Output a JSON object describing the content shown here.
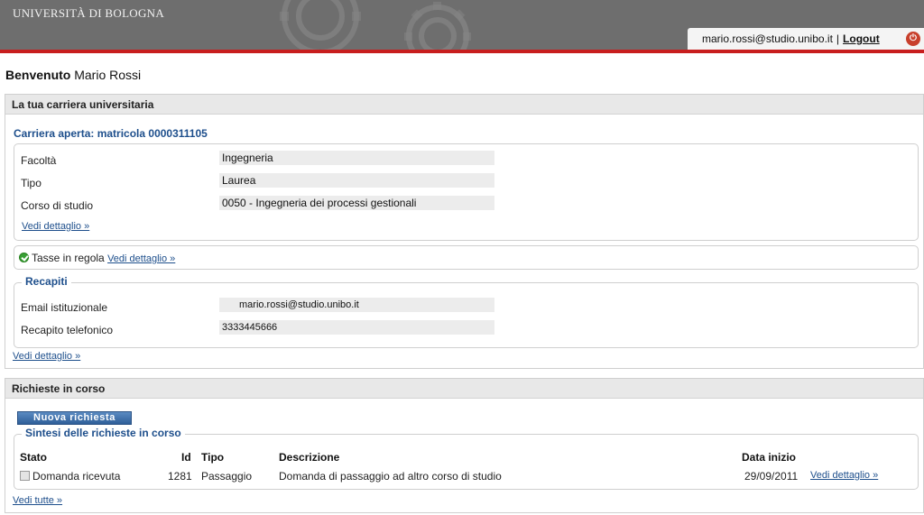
{
  "header": {
    "brand": "UNIVERSITÀ DI BOLOGNA",
    "user_email": "mario.rossi@studio.unibo.it",
    "separator": "|",
    "logout_label": "Logout",
    "accent_color": "#c81e1e"
  },
  "welcome": {
    "prefix": "Benvenuto",
    "name": "Mario Rossi"
  },
  "career": {
    "panel_title": "La tua carriera universitaria",
    "section_title": "Carriera aperta: matricola 0000311105",
    "fields": [
      {
        "label": "Facoltà",
        "value": "Ingegneria"
      },
      {
        "label": "Tipo",
        "value": "Laurea"
      },
      {
        "label": "Corso di studio",
        "value": "0050 - Ingegneria dei processi gestionali"
      }
    ],
    "details_link": "Vedi dettaglio »",
    "taxes_status": "Tasse in regola",
    "taxes_link": "Vedi dettaglio »",
    "contacts": {
      "legend": "Recapiti",
      "fields": [
        {
          "label": "Email istituzionale",
          "value": "mario.rossi@studio.unibo.it"
        },
        {
          "label": "Recapito telefonico",
          "value": "3333445666"
        }
      ]
    },
    "contacts_link": "Vedi dettaglio »"
  },
  "requests": {
    "panel_title": "Richieste in corso",
    "new_button": "Nuova richiesta",
    "legend": "Sintesi delle richieste in corso",
    "columns": {
      "status": "Stato",
      "id": "Id",
      "type": "Tipo",
      "description": "Descrizione",
      "start_date": "Data inizio"
    },
    "rows": [
      {
        "status": "Domanda ricevuta",
        "id": "1281",
        "type": "Passaggio",
        "description": "Domanda di passaggio ad altro corso di studio",
        "start_date": "29/09/2011",
        "link": "Vedi dettaglio »"
      }
    ],
    "see_all_link": "Vedi tutte »"
  }
}
